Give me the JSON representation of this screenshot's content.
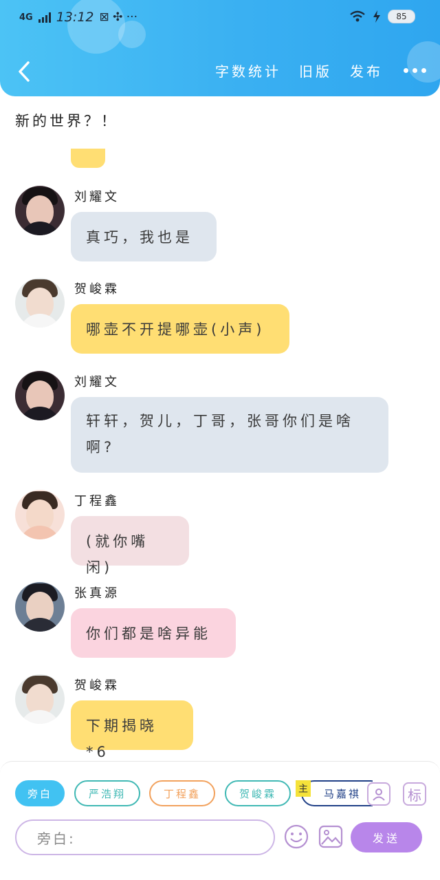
{
  "status_bar": {
    "network": "4G",
    "time": "13:12",
    "extra": "⊠ ✣ ···",
    "battery": "85"
  },
  "header": {
    "back_icon": "chevron-left-icon",
    "actions": {
      "word_count": "字数统计",
      "old_version": "旧版",
      "publish": "发布"
    },
    "more_icon": "more-dots-icon",
    "accent": "#3ab0f2"
  },
  "chapter_title": "新的世界？！",
  "messages": [
    {
      "sender": "刘耀文",
      "text": "真巧，我也是",
      "bubble_color": "#dfe6ee"
    },
    {
      "sender": "贺峻霖",
      "text": "哪壶不开提哪壶(小声)",
      "bubble_color": "#ffde73"
    },
    {
      "sender": "刘耀文",
      "text": "轩轩，贺儿，丁哥，张哥你们是啥啊?",
      "bubble_color": "#dfe6ee"
    },
    {
      "sender": "丁程鑫",
      "text": "(就你嘴闲)",
      "bubble_color": "#f3dfe2"
    },
    {
      "sender": "张真源",
      "text": "你们都是啥异能",
      "bubble_color": "#fbd4df"
    },
    {
      "sender": "贺峻霖",
      "text": "下期揭晓*6",
      "bubble_color": "#ffde73"
    }
  ],
  "role_chips": [
    {
      "label": "旁白",
      "color": "#41c2f2",
      "selected": true
    },
    {
      "label": "严浩翔",
      "color": "#3fb8b4",
      "selected": false
    },
    {
      "label": "丁程鑫",
      "color": "#f2a15c",
      "selected": false
    },
    {
      "label": "贺峻霖",
      "color": "#3fb8b4",
      "selected": false
    },
    {
      "label": "马嘉祺",
      "color": "#1f3f86",
      "selected": false,
      "badge": "主"
    }
  ],
  "tools": {
    "role_icon": "person-card-icon",
    "tag_label": "标"
  },
  "composer": {
    "placeholder": "旁白:",
    "emoji_icon": "emoji-icon",
    "image_icon": "image-icon",
    "send_label": "发送",
    "send_color": "#b886ea"
  }
}
